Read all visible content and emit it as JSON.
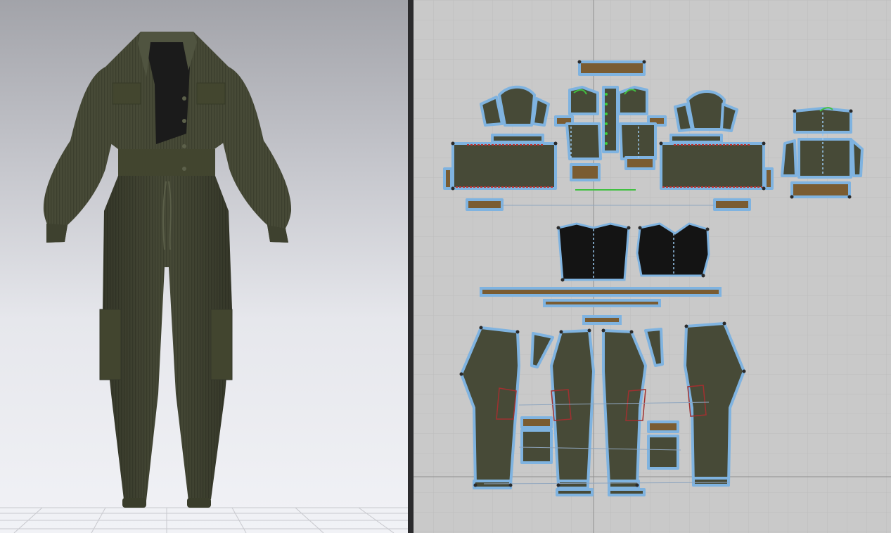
{
  "app": {
    "panels": [
      "3d-avatar-view",
      "2d-pattern-view"
    ]
  },
  "colors": {
    "fabric": "#474a37",
    "fabric_dark": "#363927",
    "fabric_light": "#565a45",
    "lining": "#161616",
    "band": "#7a5c32",
    "outline": "#7fb3e0",
    "seam_red": "#a03030",
    "seam_green": "#40c040",
    "grid_bg": "#c9c9c9",
    "viewport_top": "#a2a3a9",
    "viewport_bottom": "#f1f2f6"
  },
  "garment": {
    "type": "jumpsuit",
    "pieces_shown": 40
  }
}
